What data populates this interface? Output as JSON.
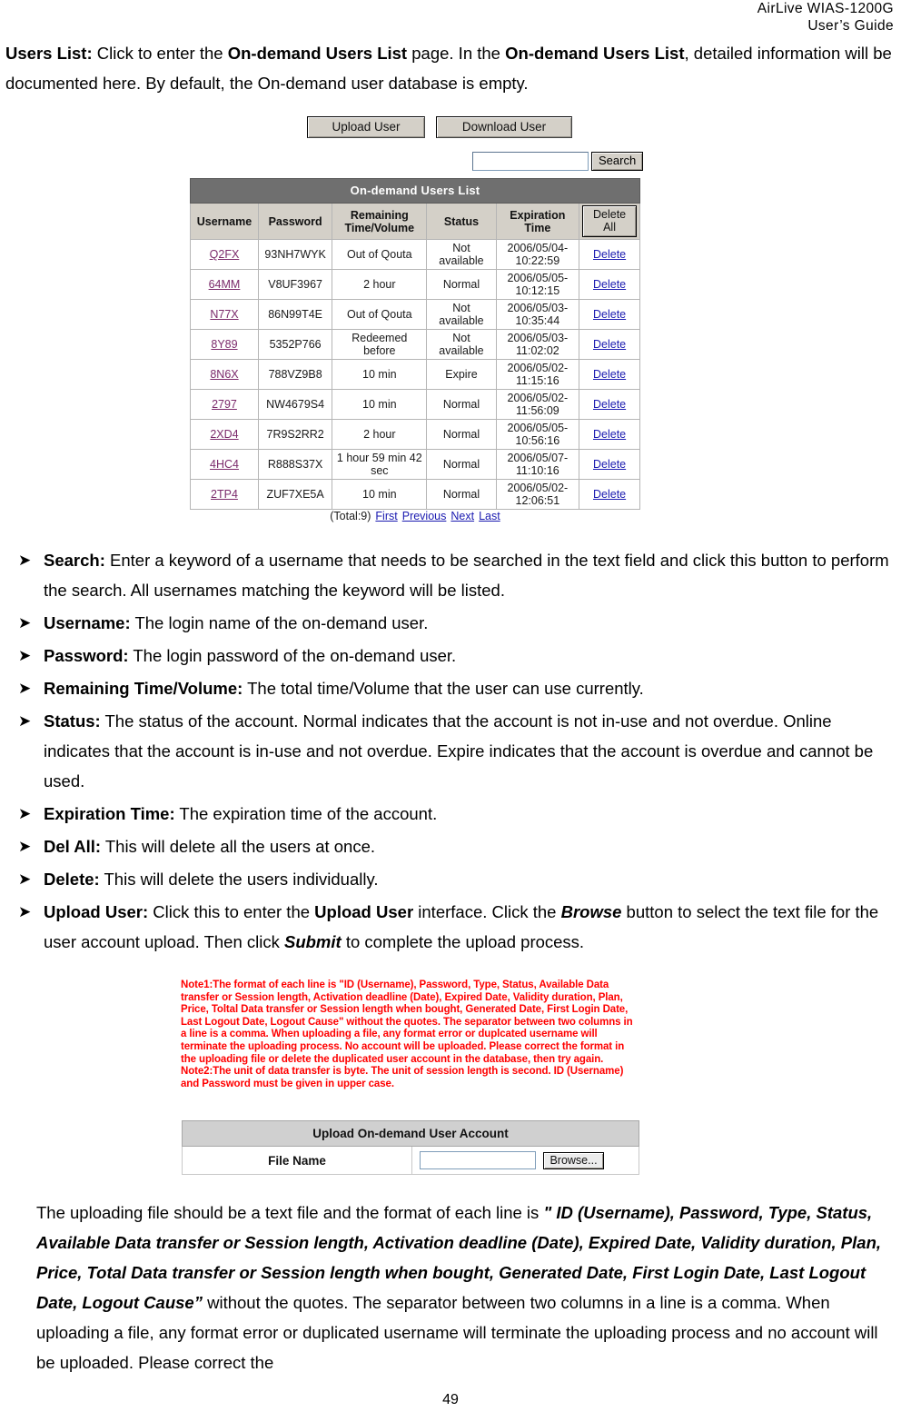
{
  "header": {
    "line1": "AirLive  WIAS-1200G",
    "line2": "User’s  Guide"
  },
  "intro": {
    "term": "Users List:",
    "t1": " Click to enter the ",
    "b1": "On-demand Users List",
    "t2": " page. In the ",
    "b2": "On-demand Users List",
    "t3": ", detailed information will be documented here. By default, the On-demand user database is empty."
  },
  "screenshot1": {
    "upload_user_button": "Upload User",
    "download_user_button": "Download User",
    "search_input_value": "",
    "search_input_placeholder": "",
    "search_button": "Search",
    "table_title": "On-demand Users List",
    "columns": [
      "Username",
      "Password",
      "Remaining Time/Volume",
      "Status",
      "Expiration Time"
    ],
    "delete_all_button": "Delete All",
    "delete_link_label": "Delete",
    "rows": [
      {
        "username": "Q2FX",
        "password": "93NH7WYK",
        "remaining": "Out of Qouta",
        "status": "Not available",
        "exp_date": "2006/05/04-",
        "exp_time": "10:22:59"
      },
      {
        "username": "64MM",
        "password": "V8UF3967",
        "remaining": "2 hour",
        "status": "Normal",
        "exp_date": "2006/05/05-",
        "exp_time": "10:12:15"
      },
      {
        "username": "N77X",
        "password": "86N99T4E",
        "remaining": "Out of Qouta",
        "status": "Not available",
        "exp_date": "2006/05/03-",
        "exp_time": "10:35:44"
      },
      {
        "username": "8Y89",
        "password": "5352P766",
        "remaining": "Redeemed before",
        "status": "Not available",
        "exp_date": "2006/05/03-",
        "exp_time": "11:02:02"
      },
      {
        "username": "8N6X",
        "password": "788VZ9B8",
        "remaining": "10 min",
        "status": "Expire",
        "exp_date": "2006/05/02-",
        "exp_time": "11:15:16"
      },
      {
        "username": "2797",
        "password": "NW4679S4",
        "remaining": "10 min",
        "status": "Normal",
        "exp_date": "2006/05/02-",
        "exp_time": "11:56:09"
      },
      {
        "username": "2XD4",
        "password": "7R9S2RR2",
        "remaining": "2 hour",
        "status": "Normal",
        "exp_date": "2006/05/05-",
        "exp_time": "10:56:16"
      },
      {
        "username": "4HC4",
        "password": "R888S37X",
        "remaining": "1 hour 59 min 42 sec",
        "status": "Normal",
        "exp_date": "2006/05/07-",
        "exp_time": "11:10:16"
      },
      {
        "username": "2TP4",
        "password": "ZUF7XE5A",
        "remaining": "10 min",
        "status": "Normal",
        "exp_date": "2006/05/02-",
        "exp_time": "12:06:51"
      }
    ],
    "pager": {
      "total": "(Total:9)",
      "first": "First",
      "previous": "Previous",
      "next": "Next",
      "last": "Last"
    }
  },
  "bullets": {
    "search": {
      "term": "Search:",
      "text": " Enter a keyword of a username that needs to be searched in the text field and click this button to perform the search. All usernames matching the keyword will be listed."
    },
    "username": {
      "term": "Username:",
      "text": " The login name of the on-demand user."
    },
    "password": {
      "term": "Password:",
      "text": " The login password of the on-demand user."
    },
    "remaining": {
      "term": "Remaining Time/Volume:",
      "text": " The total time/Volume that the user can use currently."
    },
    "status": {
      "term": "Status:",
      "text": " The status of the account. Normal indicates that the account is not in-use and not overdue. Online indicates that the account is in-use and not overdue. Expire indicates that the account is overdue and cannot be used."
    },
    "expiration": {
      "term": "Expiration Time:",
      "text": " The expiration time of the account."
    },
    "delall": {
      "term": "Del All:",
      "text": " This will delete all the users at once."
    },
    "delete": {
      "term": "Delete:",
      "text": " This will delete the users individually."
    },
    "upload": {
      "term": "Upload User:",
      "t1": " Click this to enter the ",
      "b1": "Upload User",
      "t2": " interface. Click the ",
      "i1": "Browse",
      "t3": " button to select the text file for the user account upload. Then click ",
      "i2": "Submit",
      "t4": " to complete the upload process."
    }
  },
  "screenshot2": {
    "note_text": "Note1:The format of each line is \"ID (Username), Password, Type, Status, Available Data transfer or Session length, Activation deadline (Date), Expired Date, Validity duration, Plan, Price, Toltal Data transfer or Session length when bought, Generated Date, First Login Date, Last Logout Date, Logout Cause\" without the quotes. The separator between two columns in a line is a comma. When uploading a file, any format error or duplcated username will terminate the uploading process. No account will be uploaded. Please correct the format in the uploading file or delete the duplicated user account in the database, then try again. Note2:The unit of data transfer is byte. The unit of session length is second. ID (Username) and Password must be given in upper case.",
    "panel_title": "Upload On-demand User Account",
    "file_name_label": "File Name",
    "file_input_value": "",
    "browse_button": "Browse..."
  },
  "closing": {
    "t1": "The uploading file should be a text file and the format of each line is ",
    "i1": "\" ID (Username), Password, Type, Status, Available Data transfer or Session length, Activation deadline (Date), Expired Date, Validity duration, Plan, Price, Total Data transfer or Session length when bought, Generated Date, First Login Date, Last Logout Date, Logout Cause”",
    "t2": " without the quotes. The separator between two columns in a line is a comma. When uploading a file, any format error or duplicated username will terminate the uploading process and no account will be uploaded. Please correct the"
  },
  "footer": {
    "page_number": "49"
  }
}
